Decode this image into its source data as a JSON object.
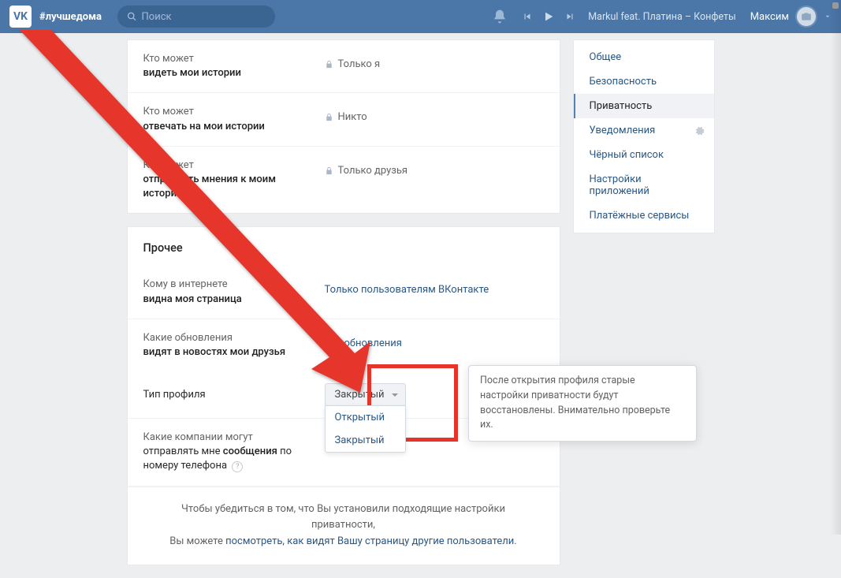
{
  "header": {
    "hashtag": "#лучшедома",
    "search_placeholder": "Поиск",
    "track": "Markul feat. Платина – Конфеты",
    "user": "Максим"
  },
  "settings": {
    "group1": [
      {
        "l1": "Кто может",
        "l2": "видеть мои истории",
        "value": "Только я",
        "locked": true
      },
      {
        "l1": "Кто может",
        "l2": "отвечать на мои истории",
        "value": "Никто",
        "locked": true
      },
      {
        "l1": "Кто может",
        "l2": "отправлять мнения к моим историям",
        "value": "Только друзья",
        "locked": true
      }
    ],
    "section_title": "Прочее",
    "group2": [
      {
        "l1": "Кому в интернете",
        "l2": "видна моя страница",
        "value": "Только пользователям ВКонтакте",
        "link": true
      },
      {
        "l1": "Какие обновления",
        "l2": "видят в новостях мои друзья",
        "value": "Все обновления",
        "link": true
      }
    ],
    "profile_type": {
      "label": "Тип профиля",
      "selected": "Закрытый",
      "options": [
        "Открытый",
        "Закрытый"
      ]
    },
    "companies": {
      "l1": "Какие компании могут",
      "l2a": "отправлять мне ",
      "l2b": "сообщения",
      "l2c": " по номеру телефона"
    }
  },
  "tooltip": "После открытия профиля старые настройки приватности будут восстановлены. Внимательно проверьте их.",
  "footer": {
    "t1": "Чтобы убедиться в том, что Вы установили подходящие настройки приватности,",
    "t2": "Вы можете ",
    "link": "посмотреть, как видят Вашу страницу другие пользователи."
  },
  "sidebar": {
    "items": [
      "Общее",
      "Безопасность",
      "Приватность",
      "Уведомления",
      "Чёрный список",
      "Настройки приложений",
      "Платёжные сервисы"
    ],
    "active_index": 2,
    "gear_index": 3
  }
}
